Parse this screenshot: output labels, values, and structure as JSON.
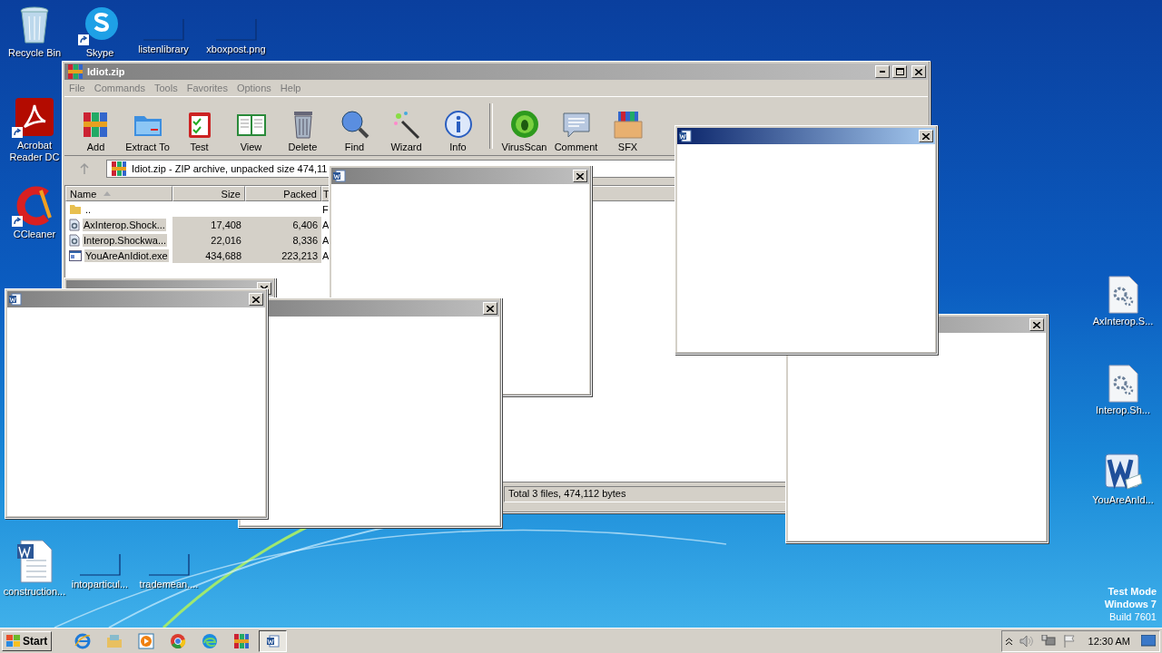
{
  "desktop_icons": [
    {
      "label": "Recycle Bin",
      "kind": "recycle",
      "shortcut": false
    },
    {
      "label": "Skype",
      "kind": "skype",
      "shortcut": true
    },
    {
      "label": "listenlibrary",
      "kind": "blank",
      "shortcut": false
    },
    {
      "label": "xboxpost.png",
      "kind": "blank",
      "shortcut": false
    },
    {
      "label": "Acrobat Reader DC",
      "kind": "pdf",
      "shortcut": true
    },
    {
      "label": "CCleaner",
      "kind": "ccleaner",
      "shortcut": true
    },
    {
      "label": "construction...",
      "kind": "word",
      "shortcut": false
    },
    {
      "label": "intoparticul...",
      "kind": "blank",
      "shortcut": false
    },
    {
      "label": "trademean....",
      "kind": "blank",
      "shortcut": false
    },
    {
      "label": "AxInterop.S...",
      "kind": "gear",
      "shortcut": false
    },
    {
      "label": "Interop.Sh...",
      "kind": "gear",
      "shortcut": false
    },
    {
      "label": "YouAreAnId...",
      "kind": "wordbig",
      "shortcut": false
    }
  ],
  "watermark": [
    "Test Mode",
    "Windows 7",
    "Build 7601"
  ],
  "archive_window": {
    "title": "Idiot.zip",
    "active": false,
    "menu": [
      "File",
      "Commands",
      "Tools",
      "Favorites",
      "Options",
      "Help"
    ],
    "toolbar": [
      [
        {
          "label": "Add",
          "kind": "add"
        },
        {
          "label": "Extract To",
          "kind": "extract"
        },
        {
          "label": "Test",
          "kind": "test"
        },
        {
          "label": "View",
          "kind": "view"
        },
        {
          "label": "Delete",
          "kind": "delete"
        },
        {
          "label": "Find",
          "kind": "find"
        },
        {
          "label": "Wizard",
          "kind": "wizard"
        },
        {
          "label": "Info",
          "kind": "info"
        }
      ],
      [
        {
          "label": "VirusScan",
          "kind": "virus"
        },
        {
          "label": "Comment",
          "kind": "comment"
        },
        {
          "label": "SFX",
          "kind": "sfx"
        }
      ]
    ],
    "address": "Idiot.zip - ZIP archive, unpacked size 474,11",
    "columns": [
      "Name",
      "Size",
      "Packed",
      "T"
    ],
    "rows": [
      {
        "kind": "folder",
        "name": "..",
        "size": "",
        "packed": "",
        "column_4": "F",
        "selected": false
      },
      {
        "kind": "dll",
        "name": "AxInterop.Shock...",
        "size": "17,408",
        "packed": "6,406",
        "column_4": "A",
        "selected": true
      },
      {
        "kind": "dll",
        "name": "Interop.Shockwa...",
        "size": "22,016",
        "packed": "8,336",
        "column_4": "A",
        "selected": true
      },
      {
        "kind": "exe",
        "name": "YouAreAnIdiot.exe",
        "size": "434,688",
        "packed": "223,213",
        "column_4": "A",
        "selected": true
      }
    ],
    "status": "Total 3 files, 474,112 bytes"
  },
  "popup_windows": [
    {
      "active": false
    },
    {
      "active": false
    },
    {
      "active": false
    },
    {
      "active": false
    },
    {
      "active": false
    },
    {
      "active": true
    }
  ],
  "taskbar": {
    "start": "Start",
    "items": [
      {
        "kind": "ie",
        "selected": false
      },
      {
        "kind": "explorer",
        "selected": false
      },
      {
        "kind": "media",
        "selected": false
      },
      {
        "kind": "chrome",
        "selected": false
      },
      {
        "kind": "edge",
        "selected": false
      },
      {
        "kind": "winrar",
        "selected": false
      },
      {
        "kind": "word",
        "selected": true
      }
    ],
    "clock": "12:30 AM"
  }
}
